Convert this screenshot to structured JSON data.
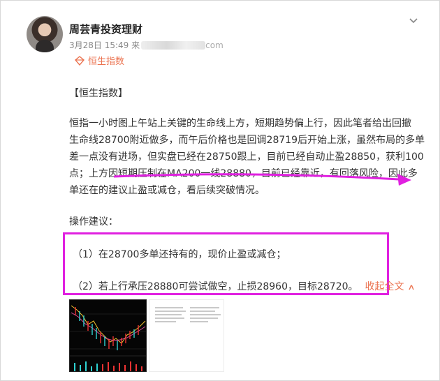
{
  "header": {
    "user_name": "周芸青投资理财",
    "time": "3月28日 15:49 来",
    "time_tail": "com",
    "topic_tag": "恒生指数"
  },
  "post": {
    "heading": "【恒生指数】",
    "paragraph_lines": [
      "恒指一小时图上午站上关键的生命线上方，短期趋势偏上行，因此笔者给出回撤",
      "生命线28700附近做多，而午后价格也是回调28719后开始上涨，虽然布局的多单",
      "差一点没有进场，但实盘已经在28750跟上，目前已经自动止盈28850，获利100",
      "点；上方因短期压制在MA200一线28880，目前已经靠近，有回落风险，因此多",
      "单还在的建议止盈或减仓，看后续突破情况。"
    ],
    "ops_label": "操作建议：",
    "advice": [
      "（1）在28700多单还持有的，现价止盈或减仓；",
      "（2）若上行承压28880可尝试做空，止损28960，目标28720。"
    ],
    "collapse_label": "收起全文",
    "collapse_icon": "chevron-up-icon"
  },
  "colors": {
    "accent": "#eb7350",
    "annotation": "#e020e0",
    "text": "#333333",
    "muted": "#888888"
  },
  "icons": {
    "menu": "chevron-down-icon",
    "topic": "diamond-topic-icon"
  }
}
